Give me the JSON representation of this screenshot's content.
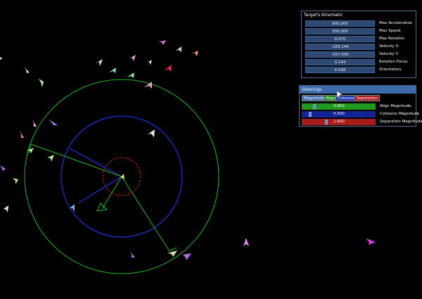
{
  "kinematic_panel": {
    "title": "Target's Kinematic",
    "rows": [
      {
        "value": "900,000",
        "label": "Max Acceleration"
      },
      {
        "value": "300,000",
        "label": "Max Speed"
      },
      {
        "value": "0.070",
        "label": "Max Rotation"
      },
      {
        "value": "-169.144",
        "label": "Velocity X:"
      },
      {
        "value": "-207.442",
        "label": "Velocity Y:"
      },
      {
        "value": "0.144",
        "label": "Rotation Force:"
      },
      {
        "value": "4.038",
        "label": "Orientation:"
      }
    ]
  },
  "steering_panel": {
    "title": "Steerings",
    "tabs": [
      {
        "label": "Magnitudes",
        "color": "#3d6aa8"
      },
      {
        "label": "Align",
        "color": "#1f8a1f"
      },
      {
        "label": "Cohesion",
        "color": "#1c2fa8"
      },
      {
        "label": "Separation",
        "color": "#a81c1c"
      }
    ],
    "sliders": [
      {
        "value": "0.800",
        "label": "Align Magnitude",
        "color": "#1f9a1f",
        "level": 0.16
      },
      {
        "value": "0.500",
        "label": "Cohesion Magnitude",
        "color": "#1c2fa8",
        "level": 0.1
      },
      {
        "value": "1.600",
        "label": "Separation Magnitude",
        "color": "#a81c1c",
        "level": 0.32
      }
    ]
  },
  "colors": {
    "align_circle": "#1fb81f",
    "cohesion_circle": "#1c2fd0",
    "separation_circle": "#d01c1c"
  }
}
